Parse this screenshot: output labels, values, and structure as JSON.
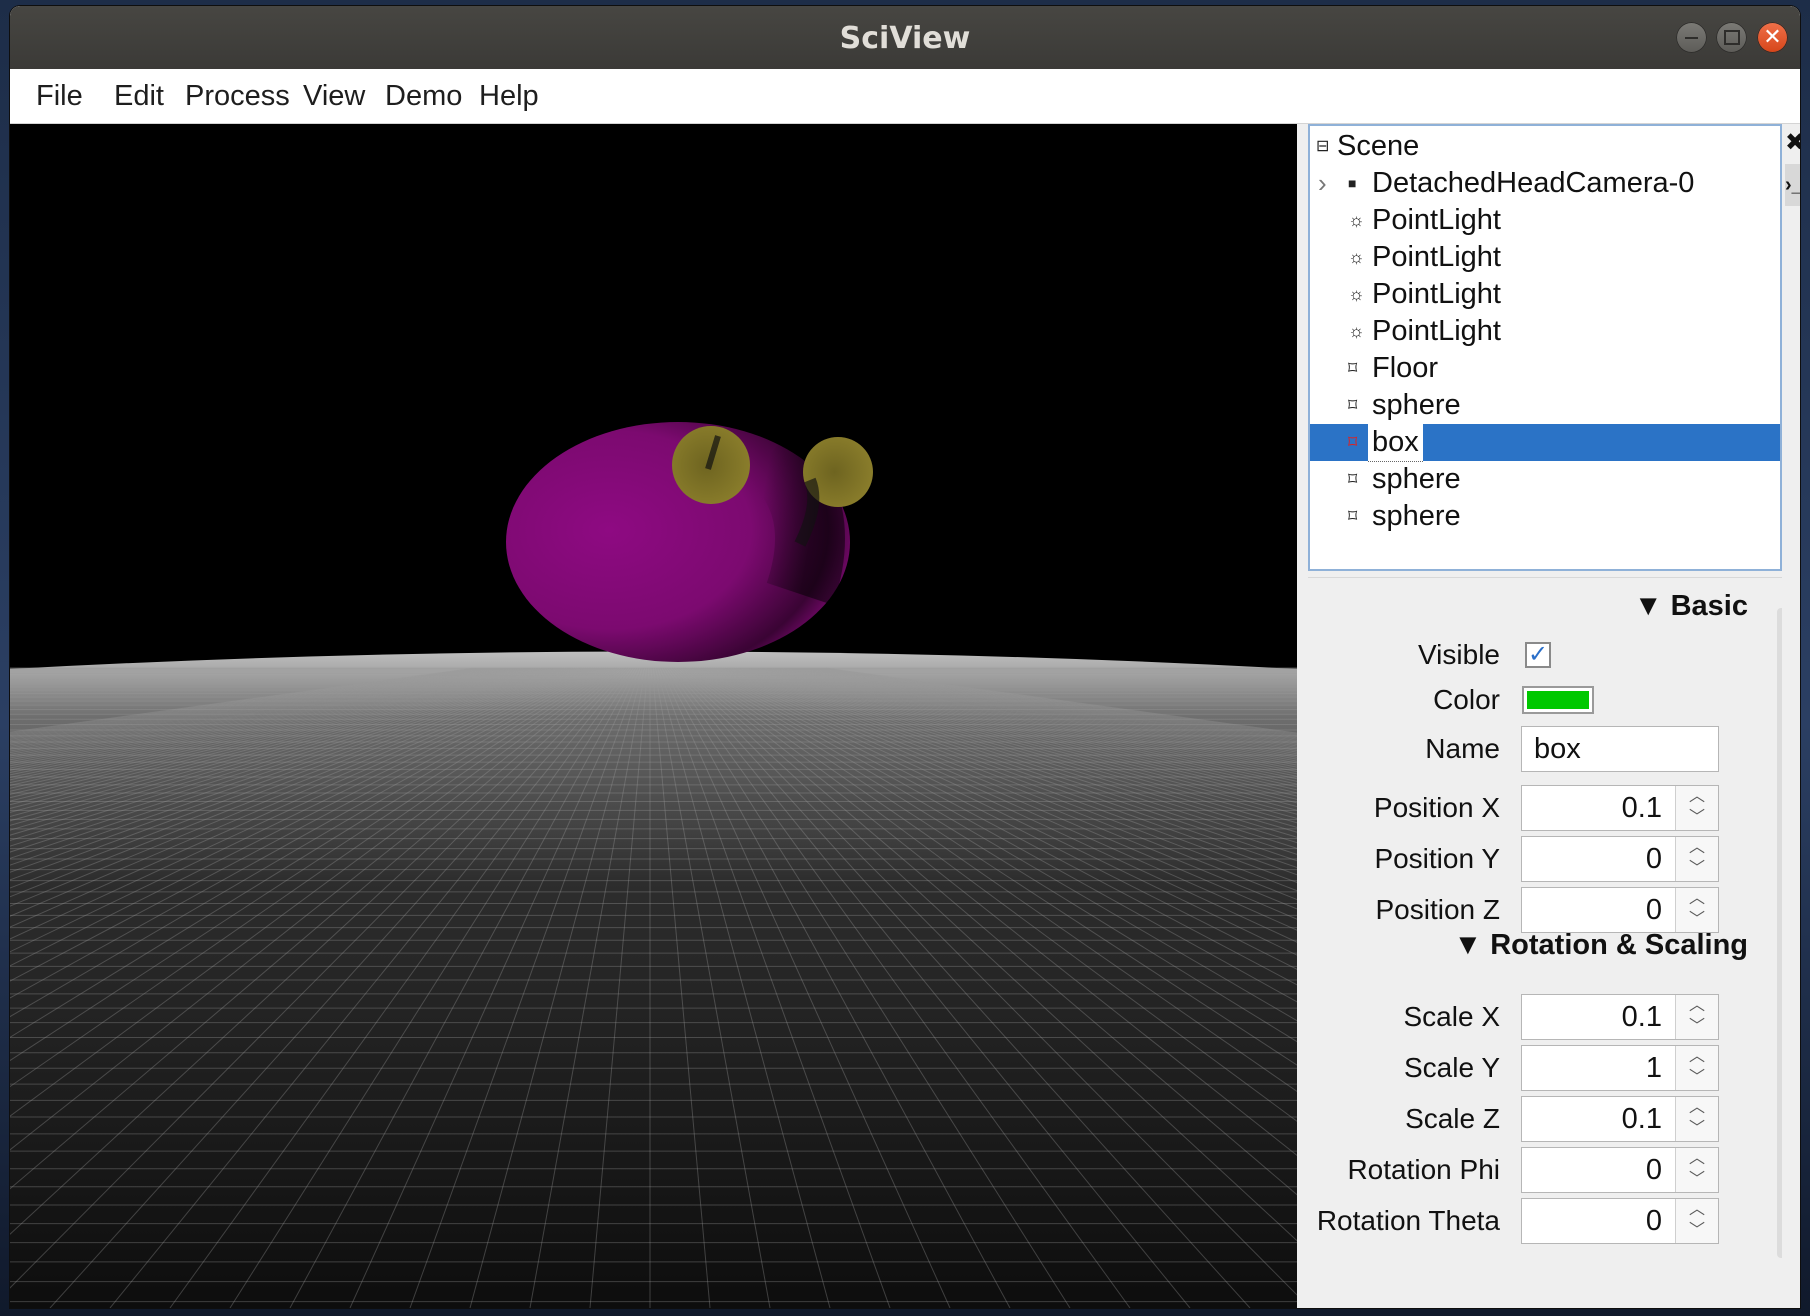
{
  "window": {
    "title": "SciView"
  },
  "menu": [
    "File",
    "Edit",
    "Process",
    "View",
    "Demo",
    "Help"
  ],
  "scene_tree": {
    "root": "Scene",
    "items": [
      {
        "label": "DetachedHeadCamera-0",
        "icon": "camera-icon",
        "expandable": true
      },
      {
        "label": "PointLight",
        "icon": "light-icon"
      },
      {
        "label": "PointLight",
        "icon": "light-icon"
      },
      {
        "label": "PointLight",
        "icon": "light-icon"
      },
      {
        "label": "PointLight",
        "icon": "light-icon"
      },
      {
        "label": "Floor",
        "icon": "mesh-icon"
      },
      {
        "label": "sphere",
        "icon": "mesh-icon"
      },
      {
        "label": "box",
        "icon": "mesh-icon",
        "selected": true
      },
      {
        "label": "sphere",
        "icon": "mesh-icon"
      },
      {
        "label": "sphere",
        "icon": "mesh-icon"
      }
    ]
  },
  "properties": {
    "basic": {
      "header": "▼ Basic",
      "visible_label": "Visible",
      "visible": true,
      "color_label": "Color",
      "color": "#00c800",
      "name_label": "Name",
      "name": "box",
      "position_x_label": "Position X",
      "position_x": "0.1",
      "position_y_label": "Position Y",
      "position_y": "0",
      "position_z_label": "Position Z",
      "position_z": "0"
    },
    "rotation_scaling": {
      "header": "▼ Rotation & Scaling",
      "scale_x_label": "Scale X",
      "scale_x": "0.1",
      "scale_y_label": "Scale Y",
      "scale_y": "1",
      "scale_z_label": "Scale Z",
      "scale_z": "0.1",
      "rotation_phi_label": "Rotation Phi",
      "rotation_phi": "0",
      "rotation_theta_label": "Rotation Theta",
      "rotation_theta": "0"
    }
  },
  "colors": {
    "selection": "#2b73c6",
    "sphere_main": "#8a0a7e",
    "sphere_small": "#7a6d22"
  }
}
